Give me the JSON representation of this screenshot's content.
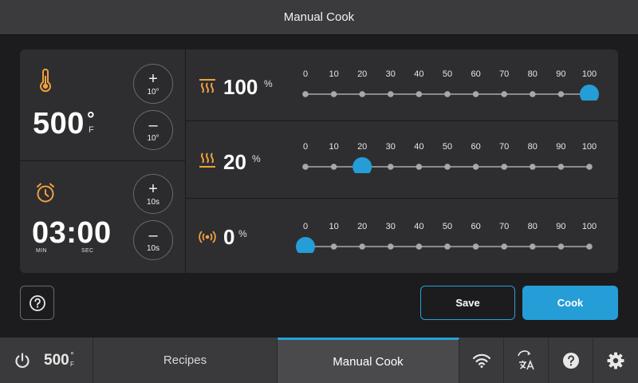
{
  "title": "Manual Cook",
  "colors": {
    "accent": "#259dd6",
    "icon_orange": "#f0a040",
    "track": "#8a8a8c",
    "panel": "#2e2e30"
  },
  "temperature": {
    "value": "500",
    "degree_symbol": "°",
    "unit": "F",
    "icon": "thermometer-icon",
    "plus_step": "10°",
    "minus_step": "10°"
  },
  "timer": {
    "value": "03:00",
    "min_label": "MIN",
    "sec_label": "SEC",
    "icon": "alarm-clock-icon",
    "plus_step": "10s",
    "minus_step": "10s"
  },
  "buttons": {
    "plus": "+",
    "minus": "–"
  },
  "sliders": {
    "ticks": [
      "0",
      "10",
      "20",
      "30",
      "40",
      "50",
      "60",
      "70",
      "80",
      "90",
      "100"
    ],
    "rows": [
      {
        "key": "convection_heat",
        "icon": "convection-heat-icon",
        "value": 100,
        "label": "100",
        "suffix": "%"
      },
      {
        "key": "bottom_heat",
        "icon": "bottom-heat-icon",
        "value": 20,
        "label": "20",
        "suffix": "%"
      },
      {
        "key": "microwave",
        "icon": "microwave-wave-icon",
        "value": 0,
        "label": "0",
        "suffix": "%"
      }
    ]
  },
  "actions": {
    "help_icon": "question-circle-icon",
    "save_label": "Save",
    "cook_label": "Cook"
  },
  "bottom_bar": {
    "power_icon": "power-icon",
    "status_temp": "500",
    "status_deg": "°",
    "status_unit": "F",
    "tab_recipes": "Recipes",
    "tab_manual": "Manual Cook",
    "icons": [
      "wifi-icon",
      "language-translate-icon",
      "help-icon",
      "settings-gear-icon"
    ]
  }
}
